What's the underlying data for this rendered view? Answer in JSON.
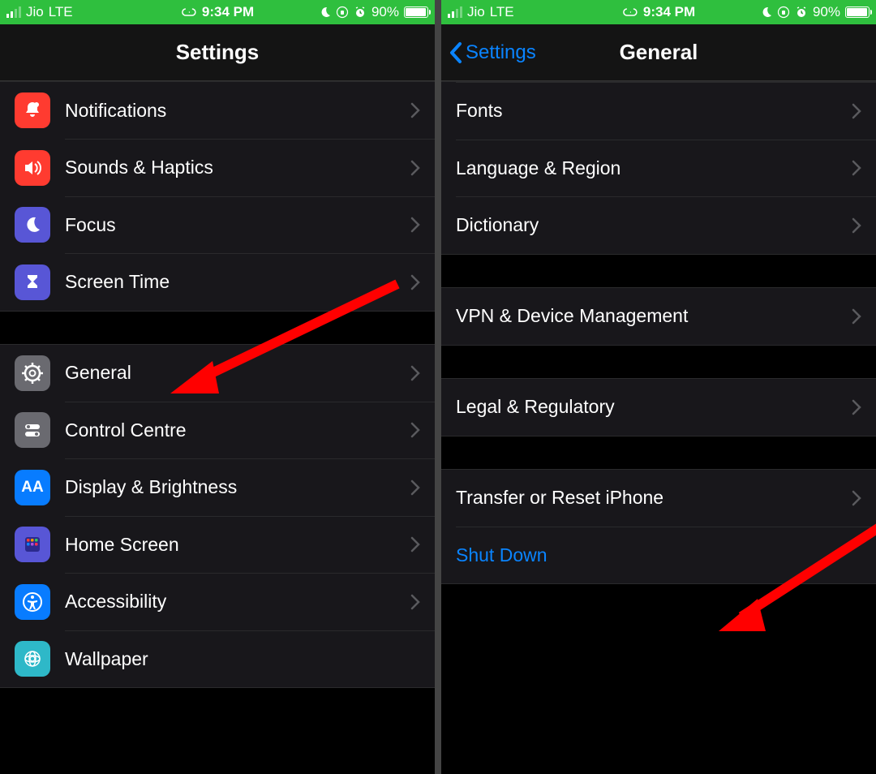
{
  "status": {
    "carrier": "Jio",
    "network": "LTE",
    "time": "9:34 PM",
    "battery_pct": "90%"
  },
  "left": {
    "title": "Settings",
    "rows1": [
      {
        "label": "Notifications",
        "icon": "bell",
        "color": "#ff3b30"
      },
      {
        "label": "Sounds & Haptics",
        "icon": "speaker",
        "color": "#ff3b30"
      },
      {
        "label": "Focus",
        "icon": "moon",
        "color": "#5856d6"
      },
      {
        "label": "Screen Time",
        "icon": "hourglass",
        "color": "#5856d6"
      }
    ],
    "rows2": [
      {
        "label": "General",
        "icon": "gear",
        "color": "#6a6a70"
      },
      {
        "label": "Control Centre",
        "icon": "toggles",
        "color": "#6a6a70"
      },
      {
        "label": "Display & Brightness",
        "icon": "aa",
        "color": "#087cff"
      },
      {
        "label": "Home Screen",
        "icon": "homescreen",
        "color": "#5856d6"
      },
      {
        "label": "Accessibility",
        "icon": "accessibility",
        "color": "#087cff"
      },
      {
        "label": "Wallpaper",
        "icon": "wallpaper",
        "color": "#2eb8c8"
      }
    ]
  },
  "right": {
    "back": "Settings",
    "title": "General",
    "g1": [
      "Fonts",
      "Language & Region",
      "Dictionary"
    ],
    "g2": [
      "VPN & Device Management"
    ],
    "g3": [
      "Legal & Regulatory"
    ],
    "g4": [
      {
        "label": "Transfer or Reset iPhone",
        "link": false
      },
      {
        "label": "Shut Down",
        "link": true
      }
    ]
  }
}
